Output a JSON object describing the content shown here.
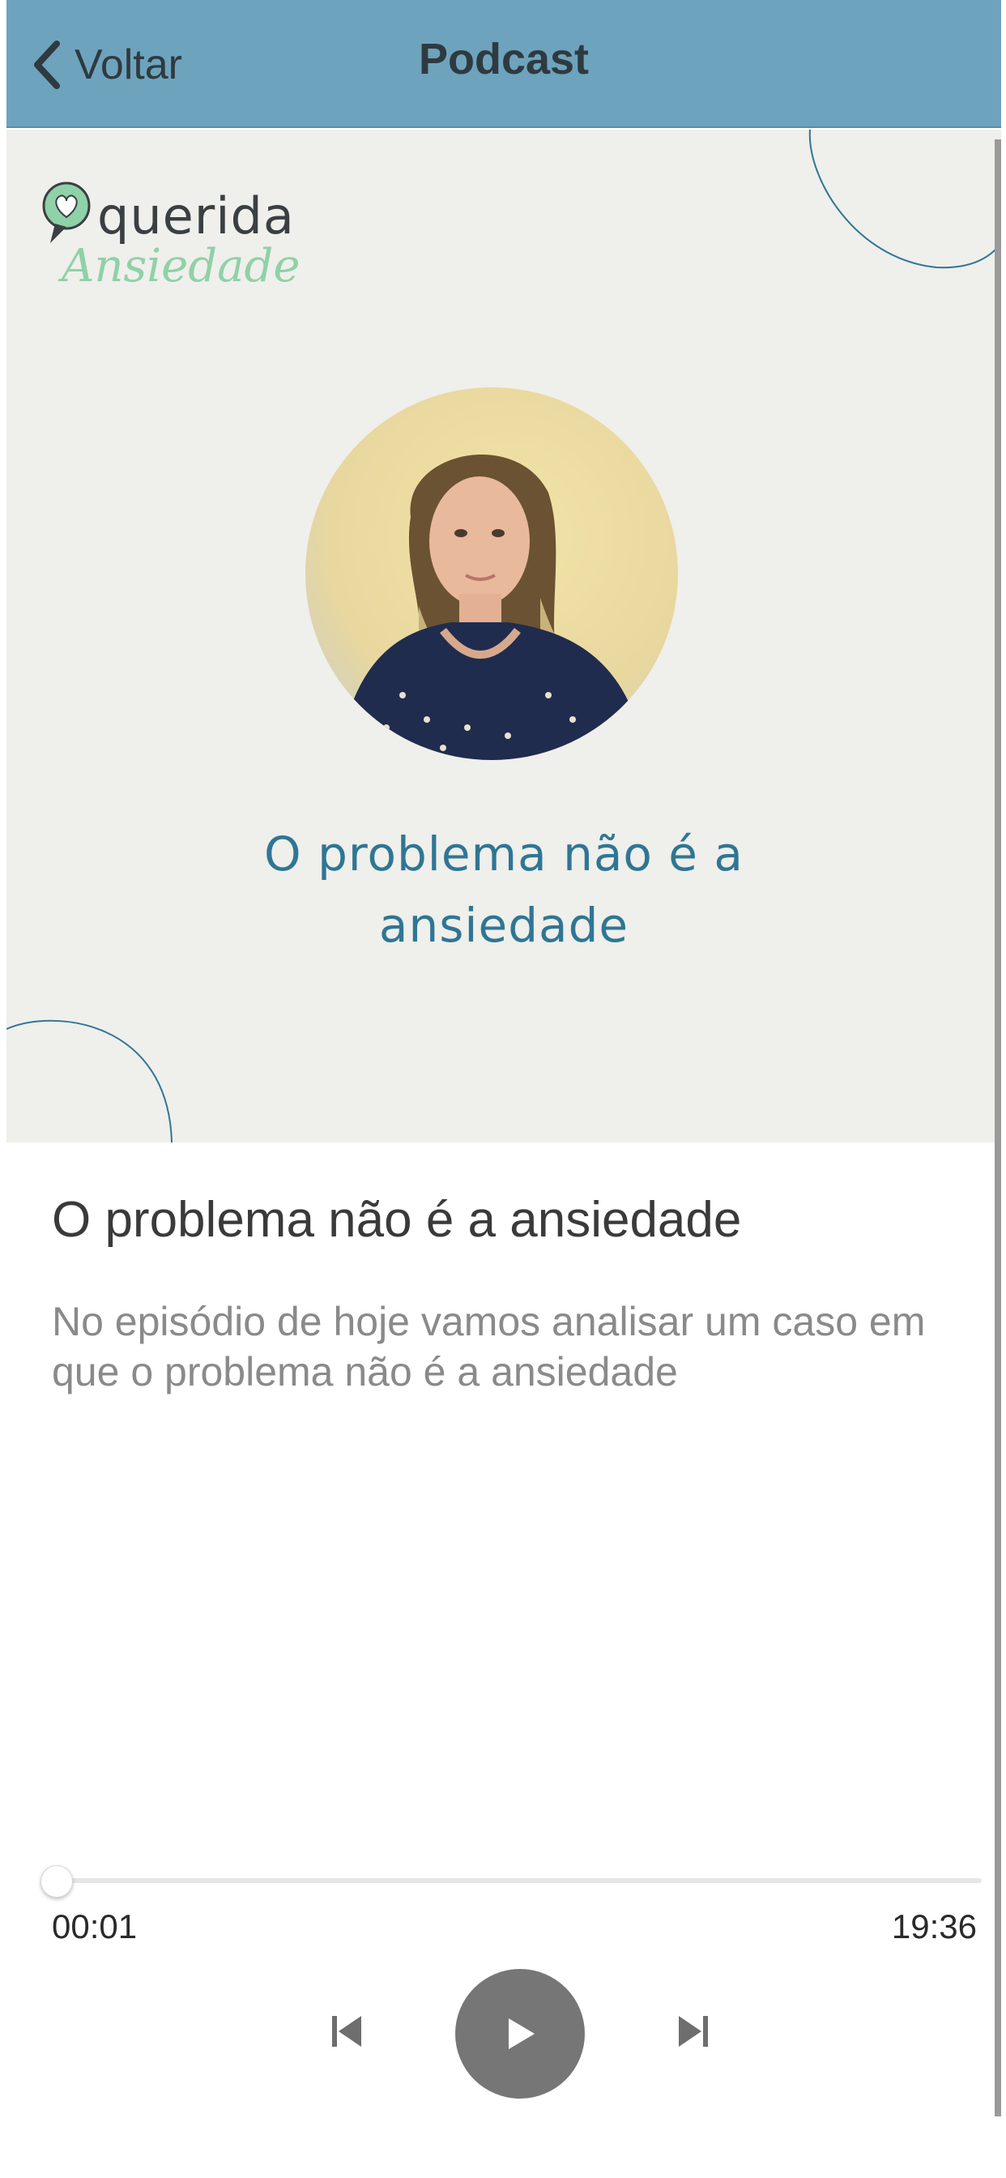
{
  "header": {
    "back_label": "Voltar",
    "title": "Podcast"
  },
  "cover": {
    "logo_line1": "querida",
    "logo_line2": "Ansiedade",
    "title_line1": "O problema não é a",
    "title_line2": "ansiedade"
  },
  "episode": {
    "title": "O problema não é a ansiedade",
    "description": "No episódio de hoje vamos analisar um caso em que o problema não é a ansiedade"
  },
  "player": {
    "current_time": "00:01",
    "total_time": "19:36",
    "progress_fraction": 0.001
  },
  "icons": {
    "back": "chevron-left-icon",
    "prev": "skip-previous-icon",
    "play": "play-icon",
    "next": "skip-next-icon"
  },
  "colors": {
    "header_bg": "#6ea3bd",
    "cover_bg": "#efefeb",
    "cover_title": "#2f7694",
    "logo_accent": "#8fd1a8",
    "play_button": "#767676"
  }
}
